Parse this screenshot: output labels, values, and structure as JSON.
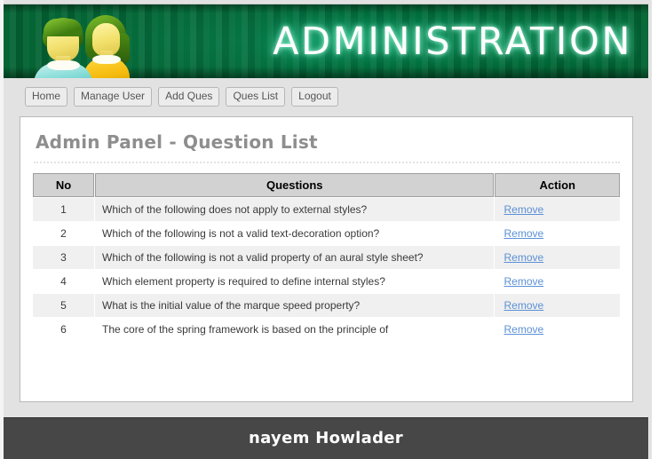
{
  "banner": {
    "title": "ADMINISTRATION",
    "avatar_icon": "two-users-icon",
    "bg_color": "#046434"
  },
  "nav": {
    "items": [
      {
        "label": "Home",
        "name": "nav-button-home"
      },
      {
        "label": "Manage User",
        "name": "nav-button-manage-user"
      },
      {
        "label": "Add Ques",
        "name": "nav-button-add-ques"
      },
      {
        "label": "Ques List",
        "name": "nav-button-ques-list"
      },
      {
        "label": "Logout",
        "name": "nav-button-logout"
      }
    ]
  },
  "panel": {
    "title": "Admin Panel - Question List"
  },
  "table": {
    "headers": [
      "No",
      "Questions",
      "Action"
    ],
    "action_label": "Remove",
    "rows": [
      {
        "no": "1",
        "question": "Which of the following does not apply to external styles?",
        "action": "Remove"
      },
      {
        "no": "2",
        "question": "Which of the following is not a valid text-decoration option?",
        "action": "Remove"
      },
      {
        "no": "3",
        "question": "Which of the following is not a valid property of an aural style sheet?",
        "action": "Remove"
      },
      {
        "no": "4",
        "question": "Which element property is required to define internal styles?",
        "action": "Remove"
      },
      {
        "no": "5",
        "question": "What is the initial value of the marque speed property?",
        "action": "Remove"
      },
      {
        "no": "6",
        "question": "The core of the spring framework is based on the principle of",
        "action": "Remove"
      }
    ]
  },
  "footer": {
    "text": "nayem Howlader",
    "bg_color": "#474747"
  },
  "colors": {
    "link": "#5b90d6",
    "title_gray": "#8e8e8e",
    "page_bg": "#e2e2e2"
  }
}
